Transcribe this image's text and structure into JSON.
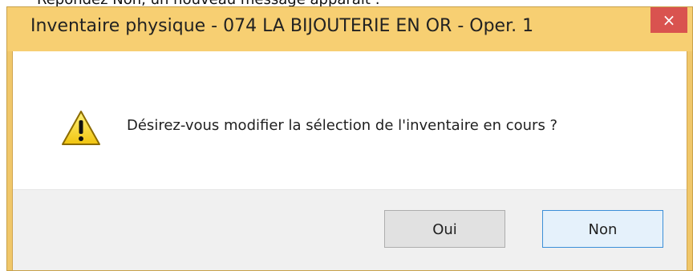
{
  "background_text": "Répondez Non, un nouveau message apparaît :",
  "dialog": {
    "title": "Inventaire physique - 074 LA BIJOUTERIE EN OR - Oper. 1",
    "close_glyph": "×",
    "icon": "warning-icon",
    "message": "Désirez-vous modifier la sélection de l'inventaire en cours ?",
    "buttons": {
      "yes_label": "Oui",
      "no_label": "Non"
    }
  },
  "colors": {
    "title_bar": "#f7cf72",
    "close_button": "#d9534f",
    "button_area": "#f0f0f0",
    "default_button_border": "#3c8fd8"
  }
}
